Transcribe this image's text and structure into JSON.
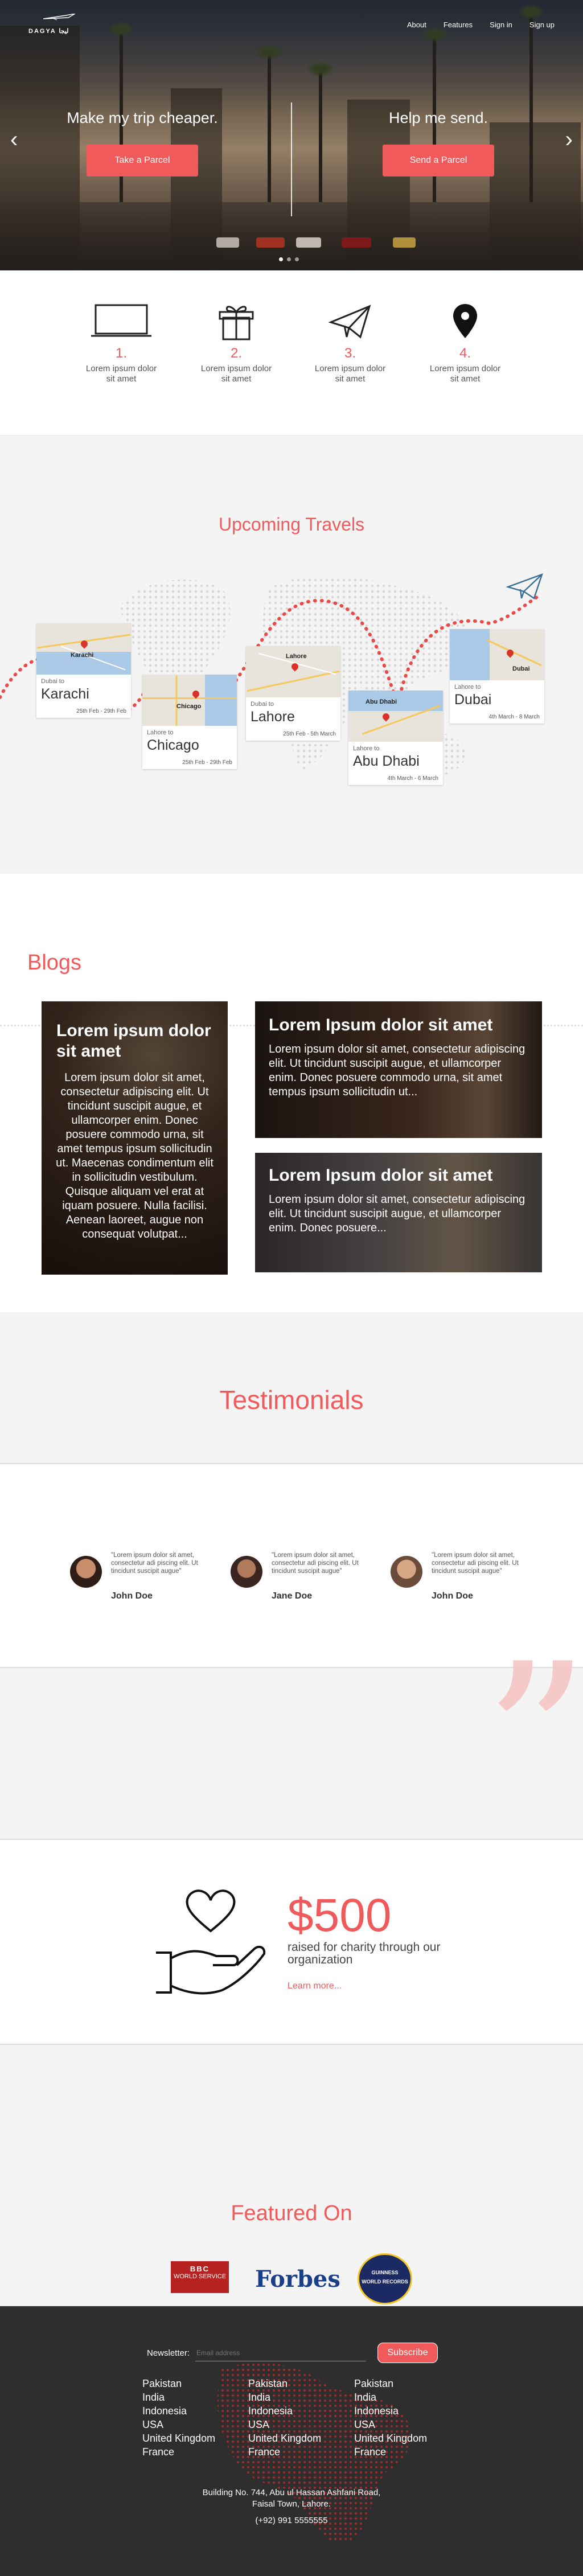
{
  "nav": {
    "logo_text": "DAGYA ليجا",
    "items": [
      {
        "label": "About"
      },
      {
        "label": "Features"
      },
      {
        "label": "Sign in"
      },
      {
        "label": "Sign up"
      }
    ]
  },
  "hero": {
    "left": {
      "heading": "Make my trip cheaper.",
      "button": "Take a Parcel"
    },
    "right": {
      "heading": "Help me send.",
      "button": "Send a Parcel"
    },
    "slide_count": 3,
    "active_slide": 1
  },
  "steps": [
    {
      "icon": "laptop-icon",
      "number": "1.",
      "text": "Lorem ipsum dolor sit amet"
    },
    {
      "icon": "gift-icon",
      "number": "2.",
      "text": "Lorem ipsum dolor sit amet"
    },
    {
      "icon": "paper-plane-icon",
      "number": "3.",
      "text": "Lorem ipsum dolor sit amet"
    },
    {
      "icon": "map-pin-icon",
      "number": "4.",
      "text": "Lorem ipsum dolor sit amet"
    }
  ],
  "travels": {
    "title": "Upcoming Travels",
    "cards": [
      {
        "from_label": "Dubai to",
        "city": "Karachi",
        "dates": "25th Feb - 29th Feb",
        "map_label": "Karachi"
      },
      {
        "from_label": "Lahore to",
        "city": "Chicago",
        "dates": "25th Feb - 29th Feb",
        "map_label": "Chicago"
      },
      {
        "from_label": "Dubai to",
        "city": "Lahore",
        "dates": "25th Feb - 5th March",
        "map_label": "Lahore"
      },
      {
        "from_label": "Lahore to",
        "city": "Abu Dhabi",
        "dates": "4th March - 6 March",
        "map_label": "Abu Dhabi"
      },
      {
        "from_label": "Lahore to",
        "city": "Dubai",
        "dates": "4th March - 8 March",
        "map_label": "Dubai"
      }
    ]
  },
  "blogs": {
    "title": "Blogs",
    "posts": [
      {
        "title": "Lorem ipsum dolor sit amet",
        "body": "Lorem ipsum dolor sit amet, consectetur adipiscing elit. Ut tincidunt suscipit augue, et ullamcorper enim. Donec posuere commodo urna, sit amet tempus ipsum sollicitudin ut. Maecenas condimentum elit in sollicitudin vestibulum. Quisque aliquam vel erat at iquam posuere. Nulla facilisi. Aenean laoreet, augue non consequat volutpat..."
      },
      {
        "title": "Lorem Ipsum dolor sit amet",
        "body": "Lorem ipsum dolor sit amet, consectetur adipiscing elit. Ut tincidunt suscipit augue, et ullamcorper enim. Donec posuere commodo urna, sit amet tempus ipsum sollicitudin ut..."
      },
      {
        "title": "Lorem Ipsum dolor sit amet",
        "body": "Lorem ipsum dolor sit amet, consectetur adipiscing elit. Ut tincidunt suscipit augue, et ullamcorper enim. Donec posuere..."
      }
    ]
  },
  "testimonials": {
    "title": "Testimonials",
    "items": [
      {
        "quote": "\"Lorem ipsum dolor sit amet, consectetur adi piscing elit. Ut tincidunt suscipit augue\"",
        "name": "John Doe"
      },
      {
        "quote": "\"Lorem ipsum dolor sit amet, consectetur adi piscing elit. Ut tincidunt suscipit augue\"",
        "name": "Jane Doe"
      },
      {
        "quote": "\"Lorem ipsum dolor sit amet, consectetur adi piscing elit. Ut tincidunt suscipit augue\"",
        "name": "John Doe"
      }
    ]
  },
  "charity": {
    "amount": "$500",
    "text": "raised for charity through our organization",
    "link": "Learn more..."
  },
  "featured": {
    "title": "Featured On",
    "bbc_line1": "BBC",
    "bbc_line2": "WORLD SERVICE",
    "forbes": "Forbes",
    "guinness_line1": "GUINNESS",
    "guinness_line2": "WORLD RECORDS"
  },
  "footer": {
    "newsletter_label": "Newsletter:",
    "email_placeholder": "Email address",
    "subscribe": "Subscribe",
    "country_columns": [
      [
        "Pakistan",
        "India",
        "Indonesia",
        "USA",
        "United Kingdom",
        "France"
      ],
      [
        "Pakistan",
        "India",
        "Indonesia",
        "USA",
        "United Kingdom",
        "France"
      ],
      [
        "Pakistan",
        "India",
        "Indonesia",
        "USA",
        "United Kingdom",
        "France"
      ]
    ],
    "address_line1": "Building No. 744, Abu ul Hassan Ashfani Road,",
    "address_line2": "Faisal Town, Lahore.",
    "phone": "(+92) 991 5555555"
  },
  "colors": {
    "accent": "#f15a5a",
    "footer_bg": "#2e2e2e",
    "section_bg": "#f4f4f4"
  }
}
